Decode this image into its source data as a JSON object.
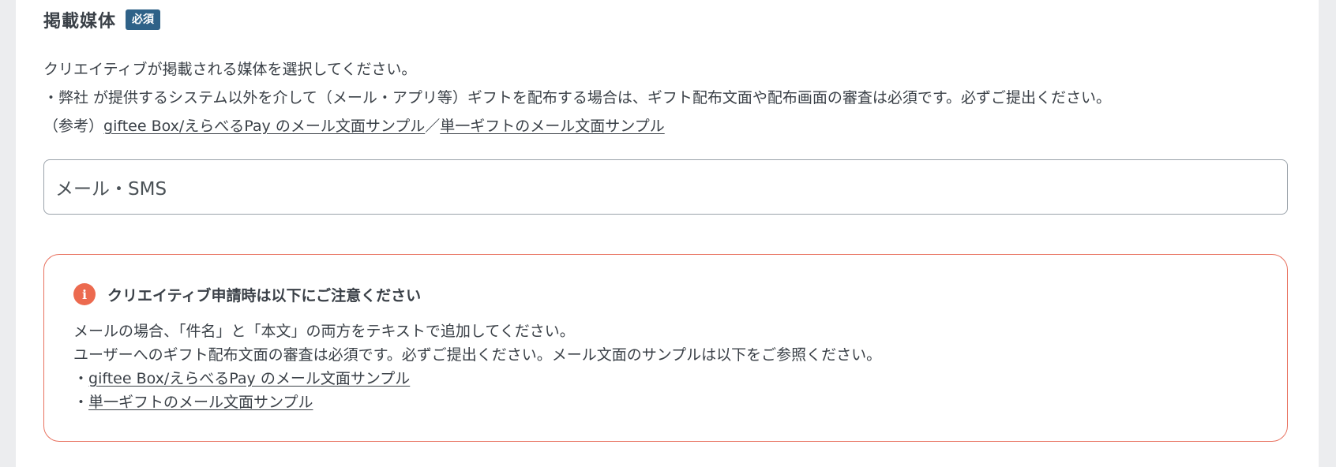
{
  "field": {
    "title": "掲載媒体",
    "required_badge": "必須",
    "description": {
      "line1": "クリエイティブが掲載される媒体を選択してください。",
      "line2": "・弊社 が提供するシステム以外を介して（メール・アプリ等）ギフトを配布する場合は、ギフト配布文面や配布画面の審査は必須です。必ずご提出ください。",
      "line3_prefix": "（参考）",
      "link1": "giftee Box/えらべるPay のメール文面サンプル",
      "separator": "／",
      "link2": "単一ギフトのメール文面サンプル"
    },
    "selected_value": "メール・SMS"
  },
  "notice": {
    "icon": "info-icon",
    "title": "クリエイティブ申請時は以下にご注意ください",
    "line1": "メールの場合、「件名」と「本文」の両方をテキストで追加してください。",
    "line2": "ユーザーへのギフト配布文面の審査は必須です。必ずご提出ください。メール文面のサンプルは以下をご参照ください。",
    "bullet": "・",
    "link1": "giftee Box/えらべるPay のメール文面サンプル",
    "link2": "単一ギフトのメール文面サンプル"
  },
  "colors": {
    "badge": "#2f6288",
    "notice_border": "#e8715f",
    "icon": "#ec6a4f"
  }
}
